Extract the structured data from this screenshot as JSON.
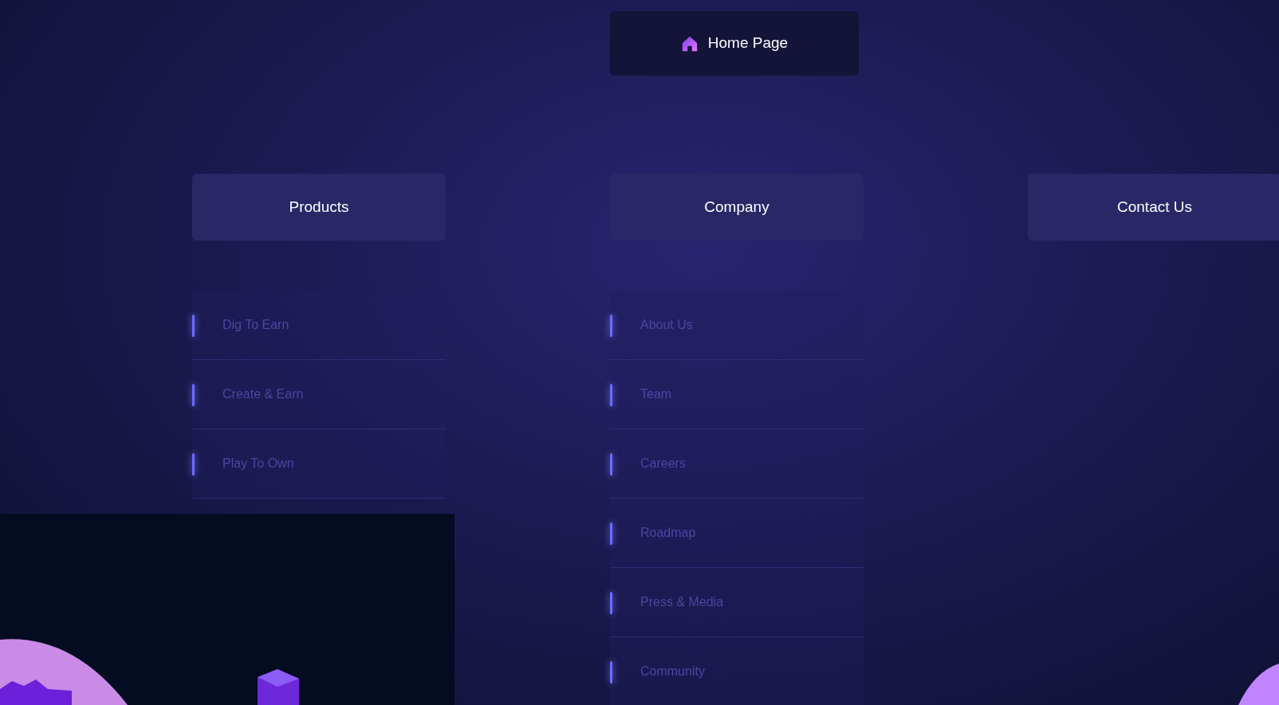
{
  "home": {
    "label": "Home Page"
  },
  "columns": [
    {
      "title": "Products",
      "items": [
        "Dig To Earn",
        "Create & Earn",
        "Play To Own"
      ]
    },
    {
      "title": "Company",
      "items": [
        "About Us",
        "Team",
        "Careers",
        "Roadmap",
        "Press & Media",
        "Community"
      ]
    },
    {
      "title": "Contact Us"
    }
  ]
}
